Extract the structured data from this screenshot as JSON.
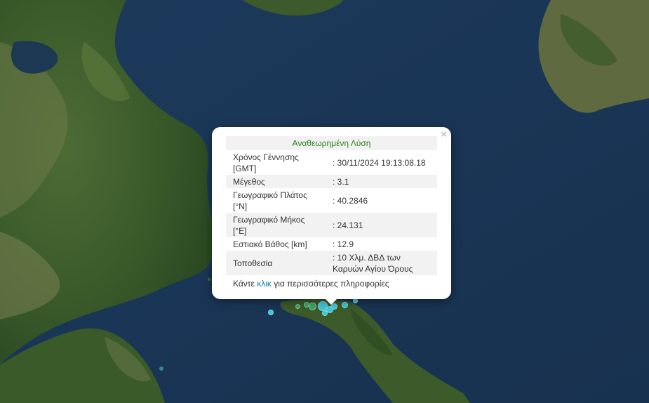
{
  "popup": {
    "title": "Αναθεωρημένη Λύση",
    "close_symbol": "×",
    "rows": [
      {
        "label": "Χρόνος Γέννησης [GMT]",
        "value": ": 30/11/2024 19:13:08.18"
      },
      {
        "label": "Μέγεθος",
        "value": ": 3.1"
      },
      {
        "label": "Γεωγραφικό Πλάτος [°N]",
        "value": ": 40.2846"
      },
      {
        "label": "Γεωγραφικό Μήκος [°E]",
        "value": ": 24.131"
      },
      {
        "label": "Εστιακό Βάθος [km]",
        "value": ": 12.9"
      },
      {
        "label": "Τοποθεσία",
        "value": ": 10 Χλμ. ΔΒΔ των Καρυών Αγίου Όρους"
      }
    ],
    "more": {
      "before": "Κάντε ",
      "link": "κλικ",
      "after": " για περισσότερες πληροφορίες"
    }
  },
  "colors": {
    "sea": "#1f3a5a",
    "land": "#3c5a2c",
    "marker_cyan": "#3fc6d6",
    "marker_green": "#3aa56a",
    "title_green": "#2e7d1a",
    "link": "#0a7fa3"
  },
  "earthquake_markers": [
    {
      "name": "quake-marker-selected",
      "color": "cyan"
    },
    {
      "name": "quake-marker",
      "color": "cyan"
    },
    {
      "name": "quake-marker",
      "color": "cyan"
    },
    {
      "name": "quake-marker",
      "color": "green"
    },
    {
      "name": "quake-marker",
      "color": "green"
    },
    {
      "name": "quake-marker",
      "color": "cyan"
    },
    {
      "name": "quake-marker",
      "color": "cyan"
    },
    {
      "name": "quake-marker",
      "color": "green"
    },
    {
      "name": "quake-marker",
      "color": "cyan"
    },
    {
      "name": "quake-marker",
      "color": "cyan"
    }
  ]
}
